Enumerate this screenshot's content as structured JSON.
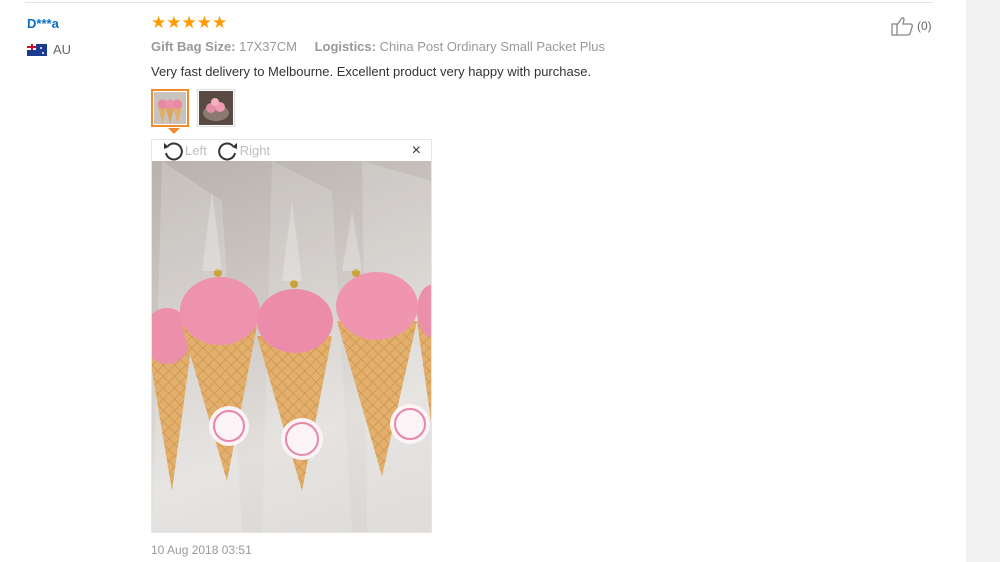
{
  "reviewer": {
    "name": "D***a",
    "country": "AU"
  },
  "rating": {
    "stars": 5,
    "max": 5
  },
  "attributes": [
    {
      "label": "Gift Bag Size:",
      "value": "17X37CM"
    },
    {
      "label": "Logistics:",
      "value": "China Post Ordinary Small Packet Plus"
    }
  ],
  "review_text": "Very fast delivery to Melbourne. Excellent product very happy with purchase.",
  "thumbnails": [
    {
      "selected": true
    },
    {
      "selected": false
    }
  ],
  "viewer": {
    "rotate_left": "Left",
    "rotate_right": "Right",
    "close": "×"
  },
  "date": "10 Aug 2018 03:51",
  "helpful": {
    "count": "(0)"
  },
  "colors": {
    "accent": "#f08a2c",
    "star": "#ff9a00",
    "link": "#0a6fc6"
  }
}
